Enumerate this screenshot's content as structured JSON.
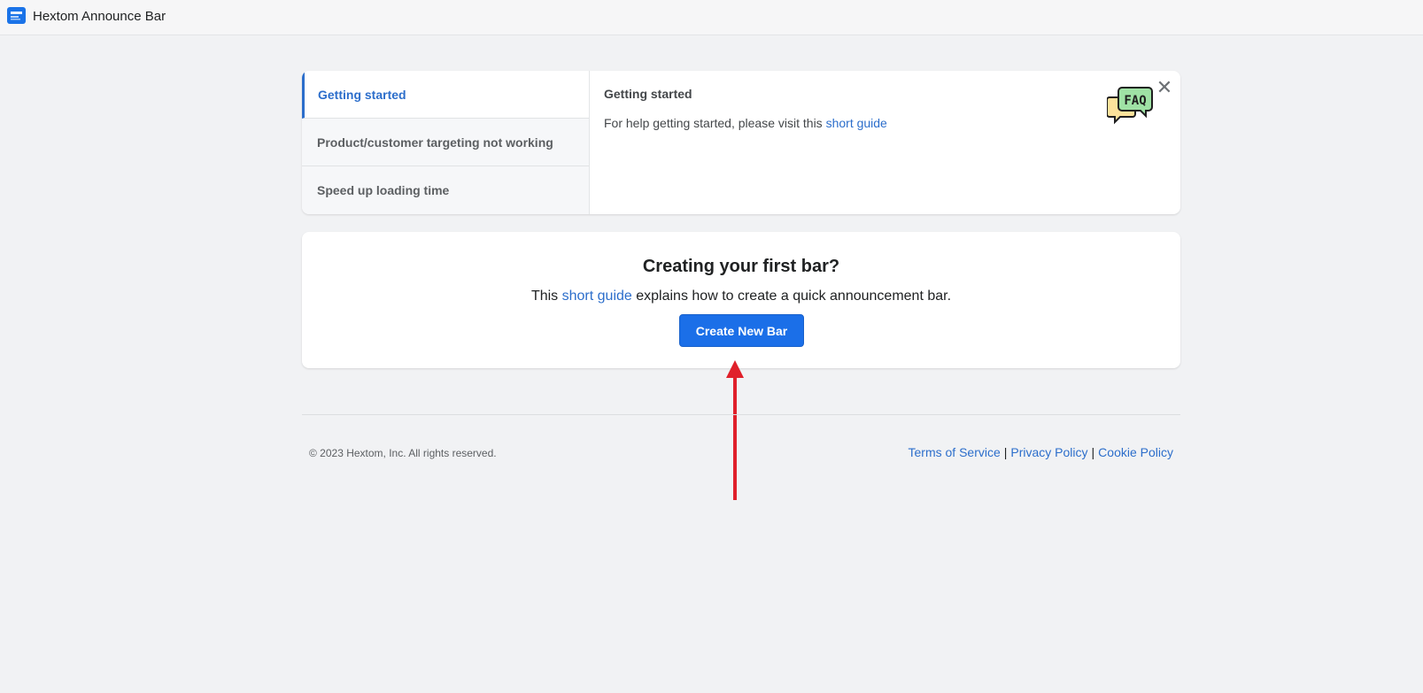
{
  "topbar": {
    "app_title": "Hextom Announce Bar",
    "icon": "app-logo-icon"
  },
  "faq": {
    "tabs": [
      {
        "label": "Getting started",
        "active": true
      },
      {
        "label": "Product/customer targeting not working",
        "active": false
      },
      {
        "label": "Speed up loading time",
        "active": false
      }
    ],
    "heading": "Getting started",
    "text_prefix": "For help getting started, please visit this ",
    "link_text": "short guide",
    "illustration_text": "FAQ",
    "close_icon": "close-icon"
  },
  "create": {
    "title": "Creating your first bar?",
    "desc_prefix": "This ",
    "desc_link": "short guide",
    "desc_suffix": " explains how to create a quick announcement bar.",
    "button_label": "Create New Bar"
  },
  "footer": {
    "copyright": "© 2023 Hextom, Inc. All rights reserved.",
    "links": [
      "Terms of Service",
      "Privacy Policy",
      "Cookie Policy"
    ],
    "separator": "|"
  },
  "colors": {
    "accent": "#2c6ecb",
    "button": "#1b6fe8",
    "annotation_arrow": "#e0202a"
  }
}
